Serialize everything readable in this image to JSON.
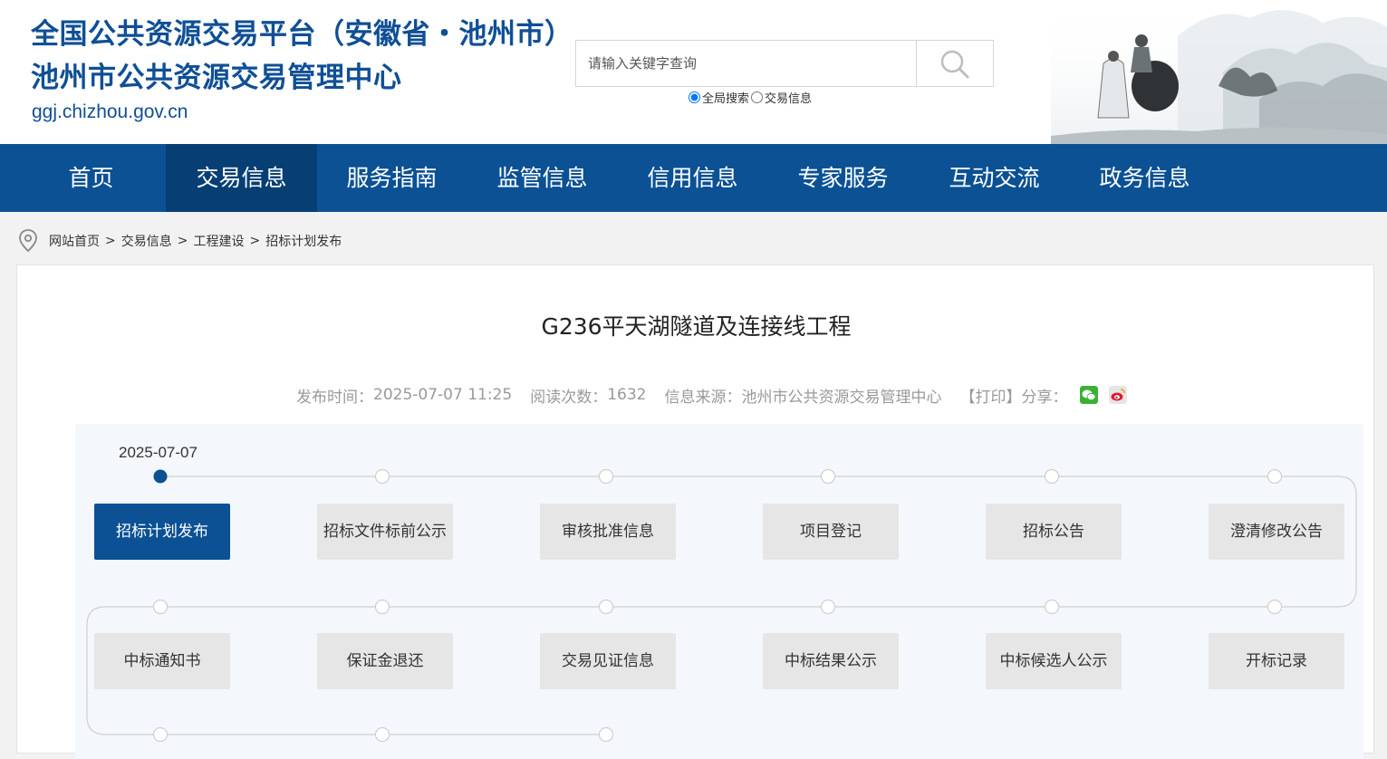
{
  "header": {
    "title_line1": "全国公共资源交易平台（安徽省・池州市）",
    "title_line2": "池州市公共资源交易管理中心",
    "domain": "ggj.chizhou.gov.cn"
  },
  "search": {
    "placeholder": "请输入关键字查询",
    "options": [
      "全局搜索",
      "交易信息"
    ],
    "selected": "全局搜索"
  },
  "nav": {
    "items": [
      "首页",
      "交易信息",
      "服务指南",
      "监管信息",
      "信用信息",
      "专家服务",
      "互动交流",
      "政务信息"
    ],
    "active": "交易信息"
  },
  "breadcrumb": [
    "网站首页",
    "交易信息",
    "工程建设",
    "招标计划发布"
  ],
  "breadcrumb_separator": ">",
  "article": {
    "title": "G236平天湖隧道及连接线工程",
    "publish_label": "发布时间：",
    "publish_time": "2025-07-07 11:25",
    "views_label": "阅读次数：",
    "views": "1632",
    "source_label": "信息来源：",
    "source": "池州市公共资源交易管理中心",
    "print": "【打印】",
    "share_label": "分享："
  },
  "timeline": {
    "current_date": "2025-07-07",
    "steps": [
      "招标计划发布",
      "招标文件标前公示",
      "审核批准信息",
      "项目登记",
      "招标公告",
      "澄清修改公告",
      "中标通知书",
      "保证金退还",
      "交易见证信息",
      "中标结果公示",
      "中标候选人公示",
      "开标记录"
    ],
    "active_index": 0
  },
  "colors": {
    "brand_blue": "#0b5194",
    "nav_active": "#073f74",
    "wechat_green": "#3cb034",
    "weibo_red": "#e6162d"
  }
}
